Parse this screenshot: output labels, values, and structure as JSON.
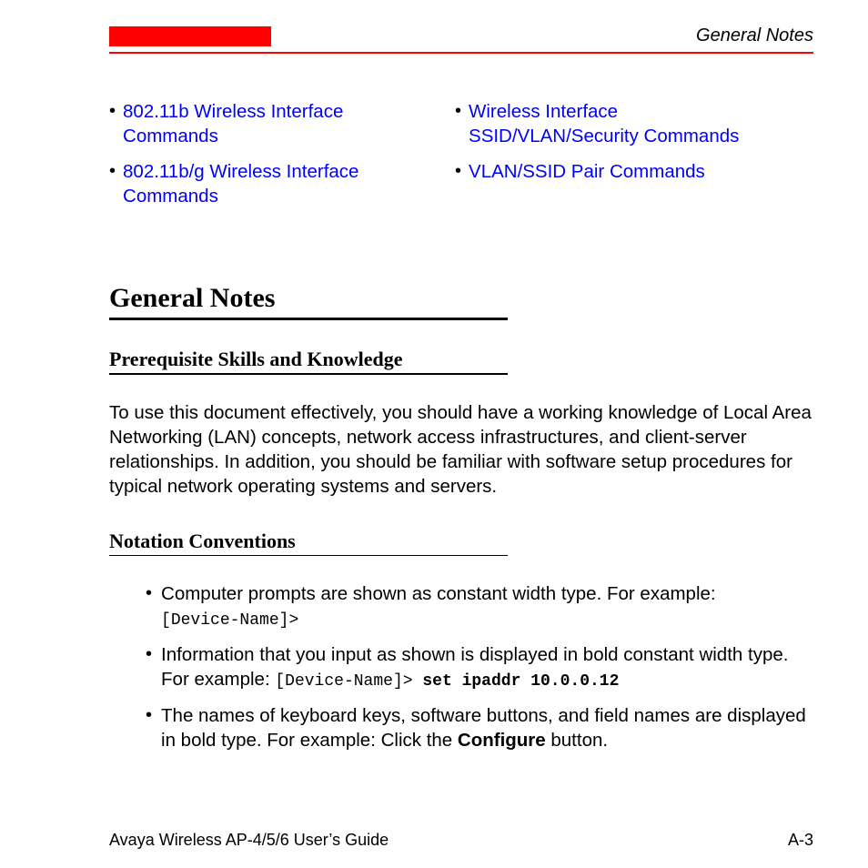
{
  "header": {
    "running_title": "General Notes"
  },
  "links": {
    "left": [
      "802.11b Wireless Interface Commands",
      "802.11b/g Wireless Interface Commands"
    ],
    "right": [
      "Wireless Interface SSID/VLAN/Security Commands",
      "VLAN/SSID Pair Commands"
    ]
  },
  "section": {
    "title": "General Notes"
  },
  "prereq": {
    "title": "Prerequisite Skills and Knowledge",
    "body": "To use this document effectively, you should have a working knowledge of Local Area Networking (LAN) concepts, network access infrastructures, and client-server relationships. In addition, you should be familiar with software setup procedures for typical network operating systems and servers."
  },
  "notation": {
    "title": "Notation Conventions",
    "item1_lead": "Computer prompts are shown as constant width type. For example: ",
    "item1_code": "[Device-Name]>",
    "item2_lead": "Information that you input as shown is displayed in bold constant width type. For example: ",
    "item2_code": "[Device-Name]> ",
    "item2_bold": "set ipaddr 10.0.0.12",
    "item3_lead": "The names of keyboard keys, software buttons, and field names are displayed in bold type. For example: Click the ",
    "item3_bold": "Configure",
    "item3_tail": " button."
  },
  "footer": {
    "book": "Avaya Wireless AP-4/5/6 User’s Guide",
    "page": "A-3"
  }
}
